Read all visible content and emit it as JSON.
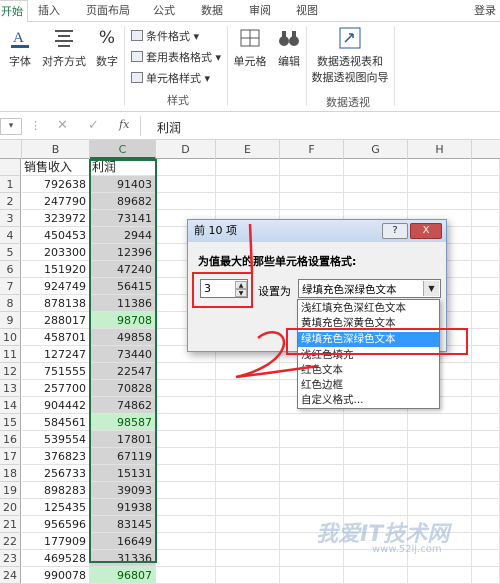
{
  "ribbon_tabs": [
    "开始",
    "插入",
    "页面布局",
    "公式",
    "数据",
    "审阅",
    "视图"
  ],
  "login": "登录",
  "ribbon": {
    "font": "字体",
    "align": "对齐方式",
    "number": "数字",
    "cond_format": "条件格式",
    "table_format": "套用表格格式",
    "cell_style": "单元格样式",
    "style_group": "样式",
    "cells": "单元格",
    "edit": "编辑",
    "pivot_line1": "数据透视表和",
    "pivot_line2": "数据透视图向导",
    "pivot_group": "数据透视",
    "pct_icon": "%"
  },
  "formula_bar": {
    "fx": "fx",
    "value": "利润"
  },
  "columns": [
    "B",
    "C",
    "D",
    "E",
    "F",
    "G",
    "H"
  ],
  "header_row": {
    "b": "销售收入",
    "c": "利润"
  },
  "rows": [
    {
      "n": "1",
      "b": "792638",
      "c": "91403",
      "hl": false
    },
    {
      "n": "2",
      "b": "247790",
      "c": "89682",
      "hl": false
    },
    {
      "n": "3",
      "b": "323972",
      "c": "73141",
      "hl": false
    },
    {
      "n": "4",
      "b": "450453",
      "c": "2944",
      "hl": false
    },
    {
      "n": "5",
      "b": "203300",
      "c": "12396",
      "hl": false
    },
    {
      "n": "6",
      "b": "151920",
      "c": "47240",
      "hl": false
    },
    {
      "n": "7",
      "b": "924749",
      "c": "56415",
      "hl": false
    },
    {
      "n": "8",
      "b": "878138",
      "c": "11386",
      "hl": false
    },
    {
      "n": "9",
      "b": "288017",
      "c": "98708",
      "hl": true
    },
    {
      "n": "10",
      "b": "458701",
      "c": "49858",
      "hl": false
    },
    {
      "n": "11",
      "b": "127247",
      "c": "73440",
      "hl": false
    },
    {
      "n": "12",
      "b": "751555",
      "c": "22547",
      "hl": false
    },
    {
      "n": "13",
      "b": "257700",
      "c": "70828",
      "hl": false
    },
    {
      "n": "14",
      "b": "904442",
      "c": "74862",
      "hl": false
    },
    {
      "n": "15",
      "b": "584561",
      "c": "98587",
      "hl": true
    },
    {
      "n": "16",
      "b": "539554",
      "c": "17801",
      "hl": false
    },
    {
      "n": "17",
      "b": "376823",
      "c": "67119",
      "hl": false
    },
    {
      "n": "18",
      "b": "256733",
      "c": "15131",
      "hl": false
    },
    {
      "n": "19",
      "b": "898283",
      "c": "39093",
      "hl": false
    },
    {
      "n": "20",
      "b": "125435",
      "c": "91938",
      "hl": false
    },
    {
      "n": "21",
      "b": "956596",
      "c": "83145",
      "hl": false
    },
    {
      "n": "22",
      "b": "177909",
      "c": "16649",
      "hl": false
    },
    {
      "n": "23",
      "b": "469528",
      "c": "31336",
      "hl": false
    },
    {
      "n": "24",
      "b": "990078",
      "c": "96807",
      "hl": true
    }
  ],
  "dialog": {
    "title": "前 10 项",
    "prompt": "为值最大的那些单元格设置格式:",
    "count": "3",
    "set_as": "设置为",
    "selected": "绿填充色深绿色文本",
    "help": "?",
    "close": "X",
    "options": [
      "浅红填充色深红色文本",
      "黄填充色深黄色文本",
      "绿填充色深绿色文本",
      "浅红色填充",
      "红色文本",
      "红色边框",
      "自定义格式..."
    ]
  },
  "annotations": {
    "one": "1",
    "two": "2"
  },
  "watermark": {
    "main": "我爱IT技术网",
    "url": "www.52ij.com"
  }
}
